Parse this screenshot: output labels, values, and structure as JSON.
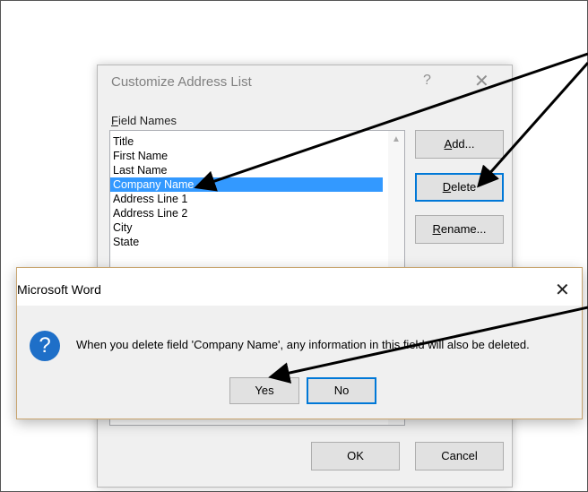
{
  "dialog": {
    "title": "Customize Address List",
    "help": "?",
    "close": "✕",
    "field_names_label_first": "F",
    "field_names_label_rest": "ield Names",
    "fields": [
      "Title",
      "First Name",
      "Last Name",
      "Company Name",
      "Address Line 1",
      "Address Line 2",
      "City",
      "State"
    ],
    "selected_field": "Company Name",
    "buttons": {
      "add_ul": "A",
      "add_rest": "dd...",
      "delete_ul": "D",
      "delete_rest": "elete",
      "rename_ul": "R",
      "rename_rest": "ename...",
      "ok": "OK",
      "cancel": "Cancel"
    }
  },
  "message_box": {
    "title": "Microsoft Word",
    "close": "✕",
    "icon": "question-icon",
    "icon_glyph": "?",
    "message": "When you delete field 'Company Name', any information in this field will also be deleted.",
    "yes": "Yes",
    "no": "No"
  },
  "colors": {
    "selection": "#3399ff",
    "arrow": "#000000",
    "focus_border": "#0078d7"
  }
}
